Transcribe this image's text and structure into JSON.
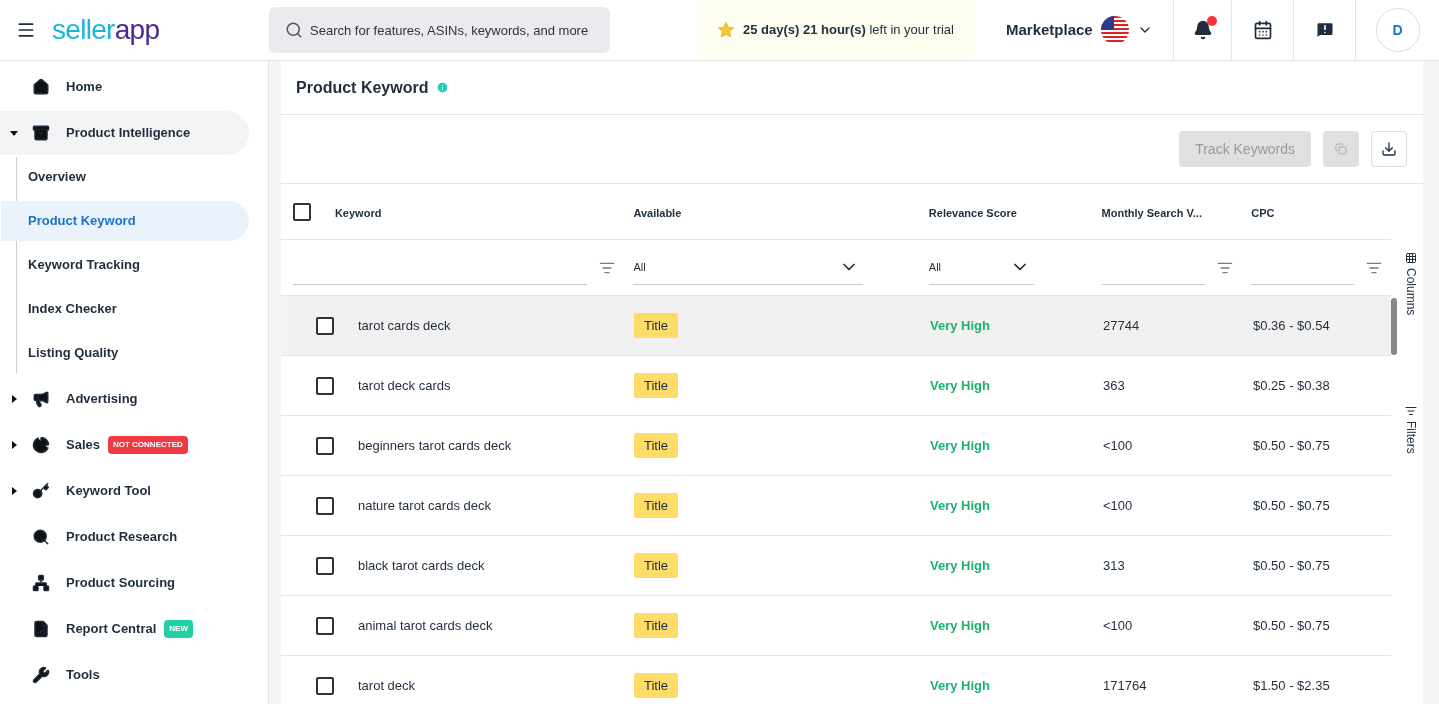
{
  "header": {
    "logo": {
      "part_1": "seller",
      "part_2": "app"
    },
    "search": {
      "placeholder": "Search for features, ASINs, keywords, and more"
    },
    "trial": "**25 day(s) 21 hour(s)** left in your trial",
    "marketplace": "Marketplace",
    "notification_dot": true,
    "avatar": "D"
  },
  "sidebar": {
    "items": [
      {
        "label": "Home",
        "selected": false
      },
      {
        "label": "Product Intelligence",
        "expanded": true,
        "selected": false,
        "children": [
          {
            "label": "Overview",
            "selected": false
          },
          {
            "label": "Product Keyword",
            "selected": true
          },
          {
            "label": "Keyword Tracking",
            "selected": false
          },
          {
            "label": "Index Checker",
            "selected": false
          },
          {
            "label": "Listing Quality",
            "selected": false
          }
        ]
      },
      {
        "label": "Advertising",
        "expanded": false,
        "selected": false
      },
      {
        "label": "Sales",
        "expanded": false,
        "selected": false,
        "badge": {
          "text": "NOT CONNECTED",
          "color": "#ef3a43"
        }
      },
      {
        "label": "Keyword Tool",
        "expanded": false,
        "selected": false
      },
      {
        "label": "Product Research",
        "selected": false
      },
      {
        "label": "Product Sourcing",
        "selected": false
      },
      {
        "label": "Report Central",
        "selected": false,
        "badge": {
          "text": "NEW",
          "color": "#1fd1a5"
        }
      },
      {
        "label": "Tools",
        "selected": false
      }
    ]
  },
  "page": {
    "title": "Product Keyword",
    "toolbar": {
      "track_button": "Track Keywords",
      "track_disabled": true,
      "copy_disabled": true
    },
    "table": {
      "select_all_checked": false,
      "columns": [
        "Keyword",
        "Available",
        "Relevance Score",
        "Monthly Search V...",
        "CPC"
      ],
      "filters": [
        {
          "kind": "text"
        },
        {
          "kind": "select",
          "value": "All"
        },
        {
          "kind": "select",
          "value": "All"
        },
        {
          "kind": "text"
        },
        {
          "kind": "text"
        }
      ],
      "rows": [
        {
          "checked": false,
          "hovered": true,
          "keyword": "tarot cards deck",
          "available": "Title",
          "relevance": "Very High",
          "volume": "27744",
          "cpc": "$0.36 - $0.54"
        },
        {
          "checked": false,
          "hovered": false,
          "keyword": "tarot deck cards",
          "available": "Title",
          "relevance": "Very High",
          "volume": "363",
          "cpc": "$0.25 - $0.38"
        },
        {
          "checked": false,
          "hovered": false,
          "keyword": "beginners tarot cards deck",
          "available": "Title",
          "relevance": "Very High",
          "volume": "<100",
          "cpc": "$0.50 - $0.75"
        },
        {
          "checked": false,
          "hovered": false,
          "keyword": "nature tarot cards deck",
          "available": "Title",
          "relevance": "Very High",
          "volume": "<100",
          "cpc": "$0.50 - $0.75"
        },
        {
          "checked": false,
          "hovered": false,
          "keyword": "black tarot cards deck",
          "available": "Title",
          "relevance": "Very High",
          "volume": "313",
          "cpc": "$0.50 - $0.75"
        },
        {
          "checked": false,
          "hovered": false,
          "keyword": "animal tarot cards deck",
          "available": "Title",
          "relevance": "Very High",
          "volume": "<100",
          "cpc": "$0.50 - $0.75"
        },
        {
          "checked": false,
          "hovered": false,
          "keyword": "tarot deck",
          "available": "Title",
          "relevance": "Very High",
          "volume": "171764",
          "cpc": "$1.50 - $2.35"
        }
      ]
    },
    "side_panel": [
      "Columns",
      "Filters"
    ]
  }
}
